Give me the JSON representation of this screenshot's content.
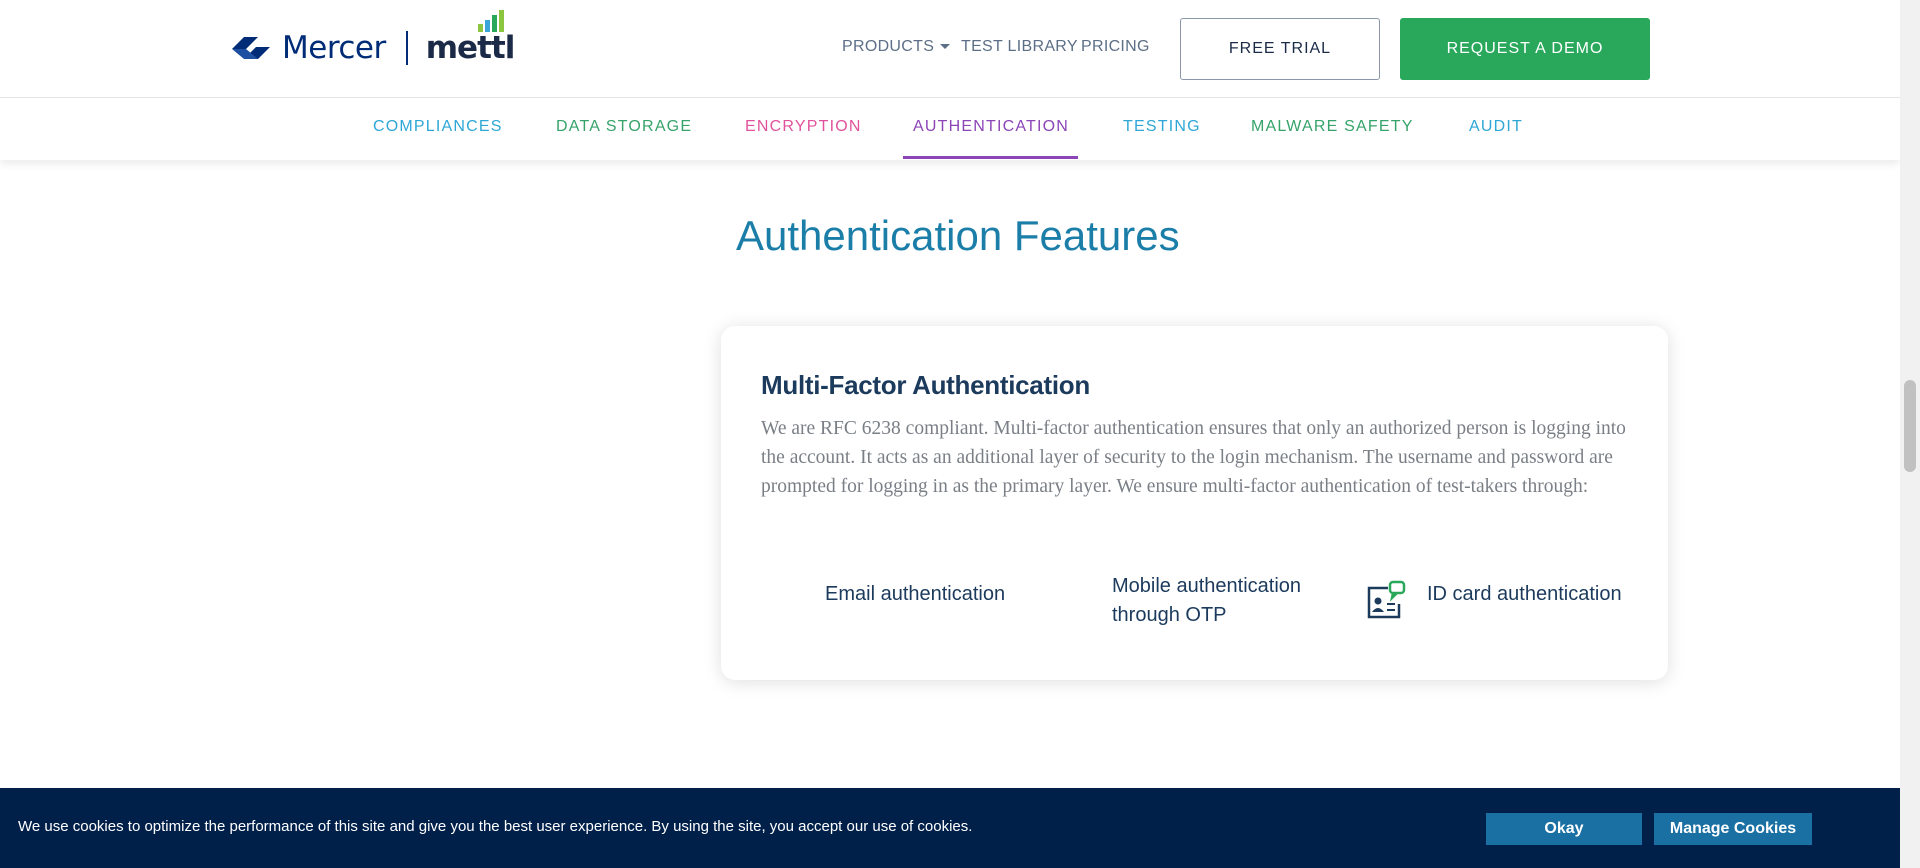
{
  "header": {
    "brand_left": "Mercer",
    "brand_right": "mettl",
    "nav": {
      "products": "PRODUCTS",
      "test_library": "TEST LIBRARY",
      "pricing": "PRICING"
    },
    "free_trial": "FREE TRIAL",
    "request_demo": "REQUEST A DEMO"
  },
  "tabs": [
    {
      "label": "COMPLIANCES",
      "color": "#2ea7d6"
    },
    {
      "label": "DATA STORAGE",
      "color": "#36a36a"
    },
    {
      "label": "ENCRYPTION",
      "color": "#e0529c"
    },
    {
      "label": "AUTHENTICATION",
      "color": "#8b45b7",
      "active": true
    },
    {
      "label": "TESTING",
      "color": "#2ea7d6"
    },
    {
      "label": "MALWARE SAFETY",
      "color": "#36a36a"
    },
    {
      "label": "AUDIT",
      "color": "#2ea7d6"
    }
  ],
  "main": {
    "title": "Authentication Features",
    "card": {
      "title": "Multi-Factor Authentication",
      "body": "We are RFC 6238 compliant. Multi-factor authentication ensures that only an authorized person is logging into the account. It acts as an additional layer of security to the login mechanism. The username and password are prompted for logging in as the primary layer. We ensure multi-factor authentication of test-takers through:",
      "methods": [
        {
          "label": "Email authentication",
          "icon": "email-icon"
        },
        {
          "label_line1": "Mobile authentication",
          "label_line2": "through OTP",
          "icon": "mobile-icon"
        },
        {
          "label": "ID card authentication",
          "icon": "id-card-icon"
        }
      ]
    }
  },
  "cookie": {
    "text": "We use cookies to optimize the performance of this site and give you the best user experience. By using the site, you accept our use of cookies.",
    "okay": "Okay",
    "manage": "Manage Cookies"
  },
  "colors": {
    "brand_navy": "#002c77",
    "primary_green": "#29a85c",
    "title_blue": "#1b7ea8",
    "active_tab": "#8b45b7",
    "cookie_bg": "#00204a",
    "cookie_btn": "#1a6fa3"
  }
}
